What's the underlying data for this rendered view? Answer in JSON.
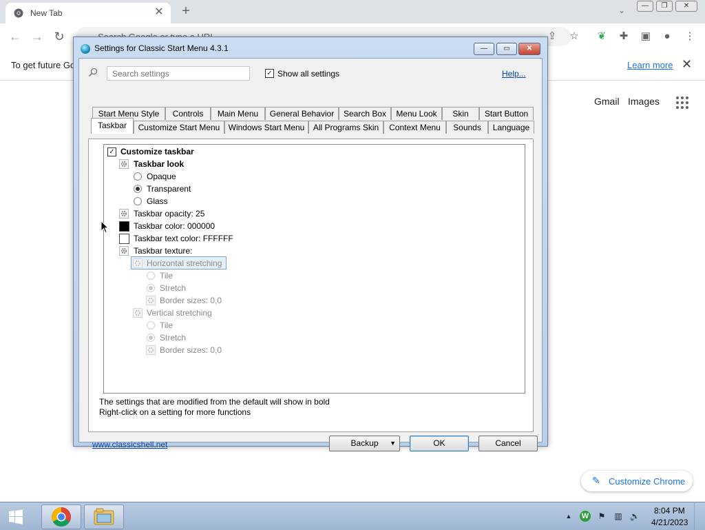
{
  "browser": {
    "tab_title": "New Tab",
    "tab_close_glyph": "✕",
    "new_tab_glyph": "+",
    "omnibox_placeholder": "Search Google or type a URL",
    "infobar_text": "To get future Go",
    "infobar_learn_more": "Learn more",
    "infobar_close_glyph": "✕",
    "links": {
      "gmail": "Gmail",
      "images": "Images"
    },
    "customize_chrome": "Customize Chrome",
    "tab_search_glyph": "⌄",
    "window_buttons": {
      "minimize": "—",
      "restore": "❐",
      "close": "✕"
    }
  },
  "dialog": {
    "title": "Settings for Classic Start Menu 4.3.1",
    "title_buttons": {
      "minimize": "—",
      "restore": "▭",
      "close": "✕"
    },
    "search_placeholder": "Search settings",
    "show_all_label": "Show all settings",
    "show_all_checked": true,
    "help_link": "Help...",
    "tabs_row1": [
      "Start Menu Style",
      "Controls",
      "Main Menu",
      "General Behavior",
      "Search Box",
      "Menu Look",
      "Skin",
      "Start Button"
    ],
    "tabs_row2": [
      "Taskbar",
      "Customize Start Menu",
      "Windows Start Menu",
      "All Programs Skin",
      "Context Menu",
      "Sounds",
      "Language"
    ],
    "selected_tab": "Taskbar",
    "tree": {
      "customize_taskbar": "Customize taskbar",
      "taskbar_look": "Taskbar look",
      "opaque": "Opaque",
      "transparent": "Transparent",
      "glass": "Glass",
      "selected_look": "Transparent",
      "opacity": "Taskbar opacity: 25",
      "color": "Taskbar color: 000000",
      "color_hex": "#000000",
      "text_color": "Taskbar text color: FFFFFF",
      "text_color_hex": "#FFFFFF",
      "texture": "Taskbar texture:",
      "horizontal_stretching": "Horizontal stretching",
      "h_tile": "Tile",
      "h_stretch": "Stretch",
      "h_border": "Border sizes: 0,0",
      "vertical_stretching": "Vertical stretching",
      "v_tile": "Tile",
      "v_stretch": "Stretch",
      "v_border": "Border sizes: 0,0"
    },
    "note_line1": "The settings that are modified from the default will show in bold",
    "note_line2": "Right-click on a setting for more functions",
    "website": "www.classicshell.net",
    "backup_button": "Backup",
    "ok_button": "OK",
    "cancel_button": "Cancel"
  },
  "taskbar": {
    "time": "8:04 PM",
    "date": "4/21/2023",
    "tray_up_glyph": "▲"
  },
  "colors": {
    "chrome_tabstrip": "#dee1e6",
    "link_blue": "#1a73e8",
    "dialog_frame": "#c9dcf1",
    "taskbar": "#b8cbe2"
  }
}
